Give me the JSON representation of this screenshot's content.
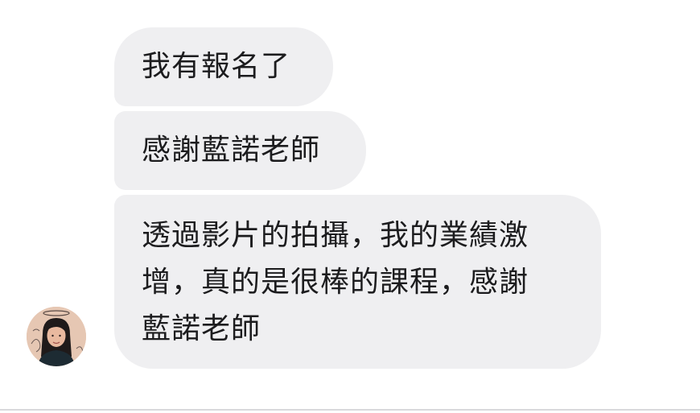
{
  "conversation": {
    "messages": [
      {
        "lines": [
          "我有報名了"
        ]
      },
      {
        "lines": [
          "感謝藍諾老師"
        ]
      },
      {
        "lines": [
          "透過影片的拍攝，我的業績激",
          "增，真的是很棒的課程，感謝",
          "藍諾老師"
        ]
      }
    ],
    "avatar": {
      "icon": "user-avatar",
      "background": "#e6c7b3"
    },
    "bubble_color": "#efeff1",
    "text_color": "#1c1c1e"
  }
}
